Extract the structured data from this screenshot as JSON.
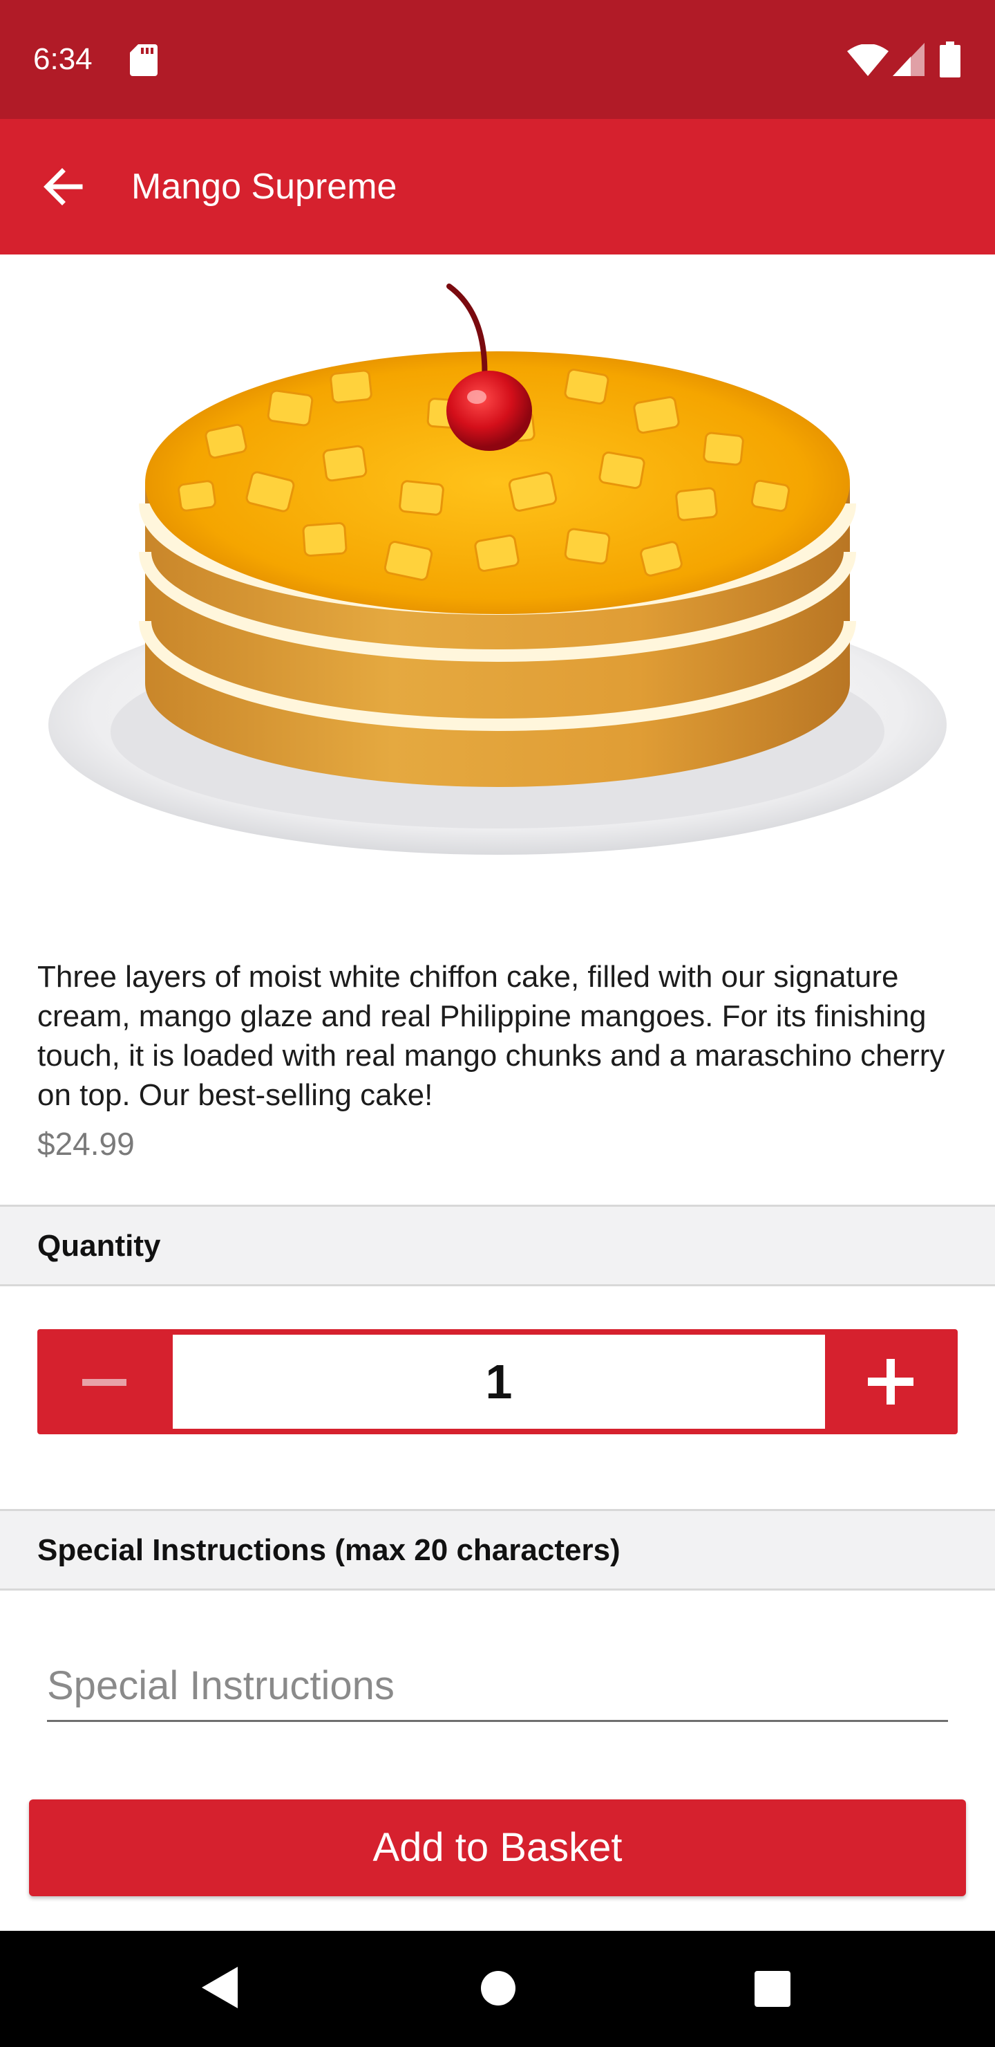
{
  "status_bar": {
    "time": "6:34"
  },
  "app_bar": {
    "title": "Mango Supreme"
  },
  "product": {
    "description": "Three layers of moist white chiffon cake, filled with our signature cream, mango glaze and real Philippine mangoes. For its finishing touch, it is loaded with real mango chunks and a maraschino cherry on top. Our best-selling cake!",
    "price": "$24.99"
  },
  "quantity_section": {
    "header": "Quantity",
    "value": "1"
  },
  "instructions_section": {
    "header": "Special Instructions (max 20 characters)",
    "placeholder": "Special Instructions"
  },
  "add_button": {
    "label": "Add to Basket"
  },
  "colors": {
    "status_bar": "#b11b27",
    "primary": "#d6212e",
    "section_bg": "#f2f2f3",
    "price_text": "#7a7a7a"
  },
  "icons": {
    "status": [
      "sd-card-icon",
      "wifi-icon",
      "signal-icon",
      "battery-icon"
    ],
    "app_bar": "back-arrow-icon",
    "nav": [
      "nav-back-icon",
      "nav-home-icon",
      "nav-recents-icon"
    ]
  }
}
